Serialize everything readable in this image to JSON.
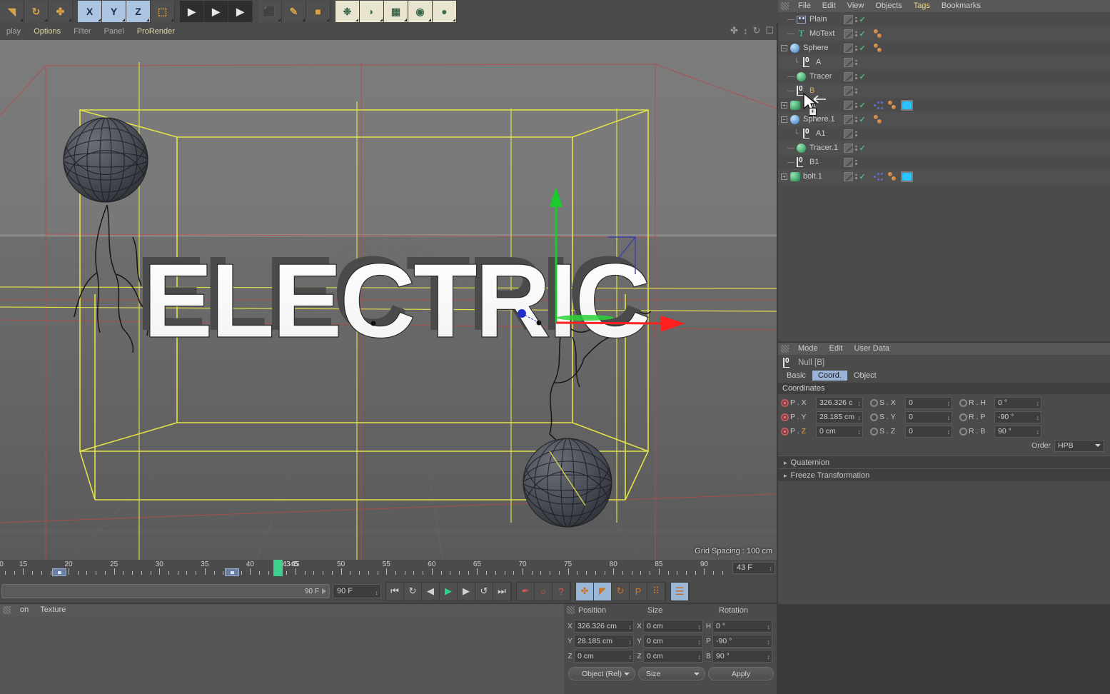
{
  "top_toolbar": {
    "buttons": [
      {
        "name": "undo-icon",
        "glyph": "◥",
        "style": "plain"
      },
      {
        "name": "redo-rotate-icon",
        "glyph": "↻",
        "style": "plain"
      },
      {
        "name": "move-tool-icon",
        "glyph": "✤",
        "style": "plain"
      },
      {
        "name": "axis-x-icon",
        "glyph": "X",
        "style": "active"
      },
      {
        "name": "axis-y-icon",
        "glyph": "Y",
        "style": "active"
      },
      {
        "name": "axis-z-icon",
        "glyph": "Z",
        "style": "active"
      },
      {
        "name": "world-object-axis-icon",
        "glyph": "⬚",
        "style": "plain"
      },
      {
        "name": "render-view-icon",
        "glyph": "▶",
        "style": "dark"
      },
      {
        "name": "render-region-icon",
        "glyph": "▶",
        "style": "dark"
      },
      {
        "name": "render-settings-icon",
        "glyph": "▶",
        "style": "dark"
      },
      {
        "name": "cube-primitive-icon",
        "glyph": "⬛",
        "style": "plain"
      },
      {
        "name": "pen-spline-icon",
        "glyph": "✎",
        "style": "plain"
      },
      {
        "name": "generator-icon",
        "glyph": "■",
        "style": "plain"
      },
      {
        "name": "deformer-icon",
        "glyph": "❉",
        "style": "cream"
      },
      {
        "name": "environment-icon",
        "glyph": "◗",
        "style": "cream"
      },
      {
        "name": "floor-icon",
        "glyph": "▦",
        "style": "cream"
      },
      {
        "name": "camera-icon",
        "glyph": "◉",
        "style": "cream"
      },
      {
        "name": "light-icon",
        "glyph": "●",
        "style": "cream"
      }
    ]
  },
  "viewport": {
    "menu": [
      "play",
      "Options",
      "Filter",
      "Panel",
      "ProRender"
    ],
    "active_menu": "Options",
    "nav_icons": [
      "pan-icon",
      "zoom-icon",
      "rotate-icon",
      "maximize-icon"
    ],
    "grid_spacing": "Grid Spacing : 100 cm",
    "scene_text": "ELECTRIC"
  },
  "timeline": {
    "numbers": [
      15,
      20,
      25,
      30,
      35,
      40,
      45,
      50,
      55,
      60,
      65,
      70,
      75,
      80,
      85,
      90
    ],
    "playhead_label": "4345",
    "current_frame_field": "43 F",
    "keyframes_at": [
      19,
      38
    ]
  },
  "anim_bar": {
    "range_label": "90 F",
    "end_frame_field": "90 F",
    "transport": [
      {
        "name": "goto-start-button",
        "glyph": "⏮"
      },
      {
        "name": "loop-button",
        "glyph": "↻"
      },
      {
        "name": "prev-key-button",
        "glyph": "◀"
      },
      {
        "name": "play-button",
        "glyph": "▶"
      },
      {
        "name": "next-key-button",
        "glyph": "▶"
      },
      {
        "name": "loop-back-button",
        "glyph": "↺"
      },
      {
        "name": "goto-end-button",
        "glyph": "⏭"
      }
    ],
    "record": [
      {
        "name": "record-keyframe-button",
        "glyph": "✒"
      },
      {
        "name": "autokey-button",
        "glyph": "○"
      },
      {
        "name": "keyframe-selection-button",
        "glyph": "?"
      }
    ],
    "key_toggles": [
      {
        "name": "key-position-button",
        "glyph": "✤",
        "on": true
      },
      {
        "name": "key-scale-button",
        "glyph": "◤",
        "on": true
      },
      {
        "name": "key-rotation-button",
        "glyph": "↻",
        "on": false
      },
      {
        "name": "key-parameter-button",
        "glyph": "P",
        "on": false
      },
      {
        "name": "key-pla-button",
        "glyph": "⠿",
        "on": false
      }
    ],
    "filmstrip": {
      "name": "timeline-window-button",
      "glyph": "☰"
    }
  },
  "material_manager": {
    "menu": [
      "on",
      "Texture"
    ]
  },
  "coordinates_manager": {
    "headers": [
      "Position",
      "Size",
      "Rotation"
    ],
    "rows": [
      {
        "axis": "X",
        "position": "326.326 cm",
        "size_axis": "X",
        "size": "0 cm",
        "rot_axis": "H",
        "rotation": "0 °"
      },
      {
        "axis": "Y",
        "position": "28.185 cm",
        "size_axis": "Y",
        "size": "0 cm",
        "rot_axis": "P",
        "rotation": "-90 °"
      },
      {
        "axis": "Z",
        "position": "0 cm",
        "size_axis": "Z",
        "size": "0 cm",
        "rot_axis": "B",
        "rotation": "90 °"
      }
    ],
    "mode_dropdown": "Object (Rel)",
    "size_dropdown": "Size",
    "apply_button": "Apply"
  },
  "object_manager": {
    "menu": [
      "File",
      "Edit",
      "View",
      "Objects",
      "Tags",
      "Bookmarks"
    ],
    "active_menu": "Tags",
    "items": [
      {
        "label": "Plain",
        "icon": "effector-icon",
        "indent": 1,
        "expand": "none",
        "visible_check": true,
        "tags": [],
        "selected": false
      },
      {
        "label": "MoText",
        "icon": "motext-icon",
        "indent": 1,
        "expand": "none",
        "visible_check": true,
        "tags": [
          "bead2"
        ],
        "selected": false
      },
      {
        "label": "Sphere",
        "icon": "sphere-icon",
        "indent": 0,
        "expand": "minus",
        "visible_check": true,
        "tags": [
          "bead2"
        ],
        "selected": false
      },
      {
        "label": "A",
        "icon": "null-icon",
        "indent": 2,
        "expand": "none",
        "visible_check": false,
        "tags": [],
        "selected": false
      },
      {
        "label": "Tracer",
        "icon": "tracer-icon",
        "indent": 1,
        "expand": "none",
        "visible_check": true,
        "tags": [],
        "selected": false
      },
      {
        "label": "B",
        "icon": "null-icon",
        "indent": 1,
        "expand": "none",
        "visible_check": false,
        "tags": [],
        "selected": true
      },
      {
        "label": "bolt",
        "icon": "bolt-icon",
        "indent": 0,
        "expand": "plus",
        "visible_check": true,
        "tags": [
          "mograph",
          "bead2",
          "blue"
        ],
        "selected": false
      },
      {
        "label": "Sphere.1",
        "icon": "sphere-icon",
        "indent": 0,
        "expand": "minus",
        "visible_check": true,
        "tags": [
          "bead2"
        ],
        "selected": false
      },
      {
        "label": "A1",
        "icon": "null-icon",
        "indent": 2,
        "expand": "none",
        "visible_check": false,
        "tags": [],
        "selected": false
      },
      {
        "label": "Tracer.1",
        "icon": "tracer-icon",
        "indent": 1,
        "expand": "none",
        "visible_check": true,
        "tags": [],
        "selected": false
      },
      {
        "label": "B1",
        "icon": "null-icon",
        "indent": 1,
        "expand": "none",
        "visible_check": false,
        "tags": [],
        "selected": false
      },
      {
        "label": "bolt.1",
        "icon": "bolt-icon",
        "indent": 0,
        "expand": "plus",
        "visible_check": true,
        "tags": [
          "mograph",
          "bead2",
          "blue"
        ],
        "selected": false
      }
    ]
  },
  "attribute_manager": {
    "menu": [
      "Mode",
      "Edit",
      "User Data"
    ],
    "object_title": "Null [B]",
    "tabs": [
      "Basic",
      "Coord.",
      "Object"
    ],
    "active_tab": "Coord.",
    "section_title": "Coordinates",
    "rows": [
      {
        "plabel": "P . X",
        "pvalue": "326.326 c",
        "slabel": "S . X",
        "svalue": "0",
        "rlabel": "R . H",
        "rvalue": "0 °",
        "z": false
      },
      {
        "plabel": "P . Y",
        "pvalue": "28.185 cm",
        "slabel": "S . Y",
        "svalue": "0",
        "rlabel": "R . P",
        "rvalue": "-90 °",
        "z": false
      },
      {
        "plabel": "P . Z",
        "pvalue": "0 cm",
        "slabel": "S . Z",
        "svalue": "0",
        "rlabel": "R . B",
        "rvalue": "90 °",
        "z": true
      }
    ],
    "order_label": "Order",
    "order_value": "HPB",
    "folds": [
      "Quaternion",
      "Freeze Transformation"
    ]
  },
  "colors": {
    "accent_blue": "#9ab3d6",
    "selection_orange": "#e0a83c",
    "check_green": "#4fb87a",
    "playhead_green": "#3fcf8e",
    "tag_blue": "#21b6f0",
    "panel_bg": "#4b4b4b"
  }
}
